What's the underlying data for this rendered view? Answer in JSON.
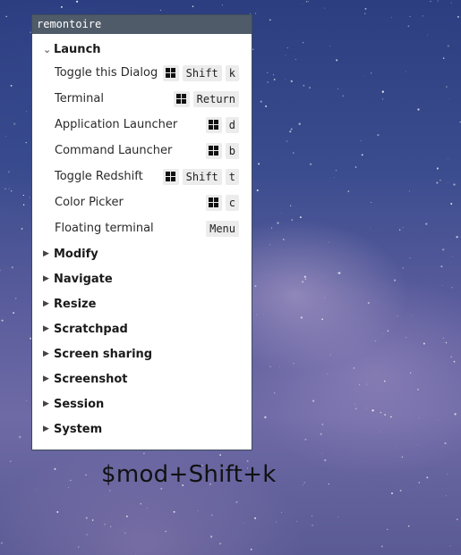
{
  "window": {
    "title": "remontoire"
  },
  "launch": {
    "label": "Launch",
    "rows": [
      {
        "label": "Toggle this Dialog",
        "keys": [
          "win",
          "Shift",
          "k"
        ]
      },
      {
        "label": "Terminal",
        "keys": [
          "win",
          "Return"
        ]
      },
      {
        "label": "Application Launcher",
        "keys": [
          "win",
          "d"
        ]
      },
      {
        "label": "Command Launcher",
        "keys": [
          "win",
          "b"
        ]
      },
      {
        "label": "Toggle Redshift",
        "keys": [
          "win",
          "Shift",
          "t"
        ]
      },
      {
        "label": "Color Picker",
        "keys": [
          "win",
          "c"
        ]
      },
      {
        "label": "Floating terminal",
        "keys": [
          "Menu"
        ]
      }
    ]
  },
  "sections": [
    {
      "label": "Modify"
    },
    {
      "label": "Navigate"
    },
    {
      "label": "Resize"
    },
    {
      "label": "Scratchpad"
    },
    {
      "label": "Screen sharing"
    },
    {
      "label": "Screenshot"
    },
    {
      "label": "Session"
    },
    {
      "label": "System"
    }
  ],
  "overlay": {
    "text": "$mod+Shift+k"
  },
  "colors": {
    "titlebar": "#4f5b69",
    "key_bg": "#ececec",
    "window_bg": "#ffffff"
  },
  "icons": {
    "super_key": "windows-logo-icon",
    "expanded": "chevron-down-icon",
    "collapsed": "triangle-right-icon"
  }
}
